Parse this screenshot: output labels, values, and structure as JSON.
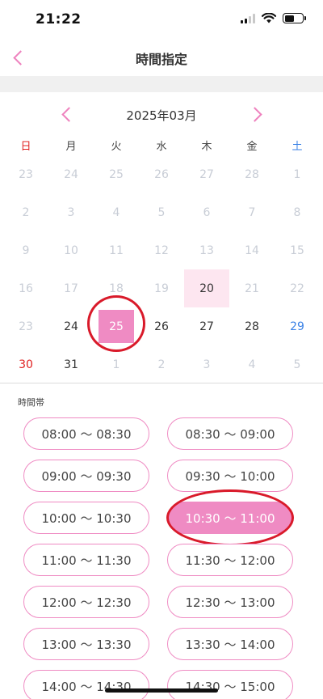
{
  "status_bar": {
    "time": "21:22"
  },
  "header": {
    "title": "時間指定"
  },
  "calendar": {
    "month_label": "2025年03月",
    "weekdays": [
      "日",
      "月",
      "火",
      "水",
      "木",
      "金",
      "土"
    ],
    "days": [
      {
        "label": "23",
        "state": "muted"
      },
      {
        "label": "24",
        "state": "muted"
      },
      {
        "label": "25",
        "state": "muted"
      },
      {
        "label": "26",
        "state": "muted"
      },
      {
        "label": "27",
        "state": "muted"
      },
      {
        "label": "28",
        "state": "muted"
      },
      {
        "label": "1",
        "state": "muted"
      },
      {
        "label": "2",
        "state": "muted"
      },
      {
        "label": "3",
        "state": "muted"
      },
      {
        "label": "4",
        "state": "muted"
      },
      {
        "label": "5",
        "state": "muted"
      },
      {
        "label": "6",
        "state": "muted"
      },
      {
        "label": "7",
        "state": "muted"
      },
      {
        "label": "8",
        "state": "muted"
      },
      {
        "label": "9",
        "state": "muted"
      },
      {
        "label": "10",
        "state": "muted"
      },
      {
        "label": "11",
        "state": "muted"
      },
      {
        "label": "12",
        "state": "muted"
      },
      {
        "label": "13",
        "state": "muted"
      },
      {
        "label": "14",
        "state": "muted"
      },
      {
        "label": "15",
        "state": "muted"
      },
      {
        "label": "16",
        "state": "muted"
      },
      {
        "label": "17",
        "state": "muted"
      },
      {
        "label": "18",
        "state": "muted"
      },
      {
        "label": "19",
        "state": "muted"
      },
      {
        "label": "20",
        "state": "today"
      },
      {
        "label": "21",
        "state": "muted"
      },
      {
        "label": "22",
        "state": "muted"
      },
      {
        "label": "23",
        "state": "muted"
      },
      {
        "label": "24",
        "state": "active"
      },
      {
        "label": "25",
        "state": "selected"
      },
      {
        "label": "26",
        "state": "active"
      },
      {
        "label": "27",
        "state": "active"
      },
      {
        "label": "28",
        "state": "active"
      },
      {
        "label": "29",
        "state": "active-sat"
      },
      {
        "label": "30",
        "state": "active-sun"
      },
      {
        "label": "31",
        "state": "active"
      },
      {
        "label": "1",
        "state": "muted"
      },
      {
        "label": "2",
        "state": "muted"
      },
      {
        "label": "3",
        "state": "muted"
      },
      {
        "label": "4",
        "state": "muted"
      },
      {
        "label": "5",
        "state": "muted"
      }
    ]
  },
  "time_section": {
    "label": "時間帯",
    "slots": [
      {
        "label": "08:00 ～ 08:30",
        "selected": false
      },
      {
        "label": "08:30 ～ 09:00",
        "selected": false
      },
      {
        "label": "09:00 ～ 09:30",
        "selected": false
      },
      {
        "label": "09:30 ～ 10:00",
        "selected": false
      },
      {
        "label": "10:00 ～ 10:30",
        "selected": false
      },
      {
        "label": "10:30 ～ 11:00",
        "selected": true
      },
      {
        "label": "11:00 ～ 11:30",
        "selected": false
      },
      {
        "label": "11:30 ～ 12:00",
        "selected": false
      },
      {
        "label": "12:00 ～ 12:30",
        "selected": false
      },
      {
        "label": "12:30 ～ 13:00",
        "selected": false
      },
      {
        "label": "13:00 ～ 13:30",
        "selected": false
      },
      {
        "label": "13:30 ～ 14:00",
        "selected": false
      },
      {
        "label": "14:00 ～ 14:30",
        "selected": false
      },
      {
        "label": "14:30 ～ 15:00",
        "selected": false
      }
    ]
  },
  "colors": {
    "accent_pink": "#ef8bc3",
    "today_bg": "#fde6f0",
    "annotation_red": "#d91a2a",
    "sunday_red": "#e02020",
    "saturday_blue": "#3b82e6"
  },
  "icons": {
    "back": "chevron-left-icon",
    "prev_month": "chevron-left-icon",
    "next_month": "chevron-right-icon"
  }
}
